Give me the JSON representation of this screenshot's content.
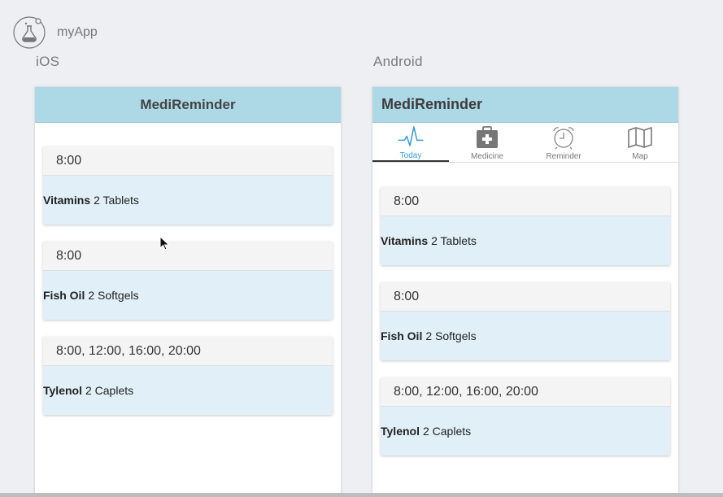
{
  "app": {
    "name": "myApp"
  },
  "platforms": {
    "ios_label": "iOS",
    "android_label": "Android"
  },
  "screen": {
    "title": "MediReminder"
  },
  "tabs": [
    {
      "label": "Today",
      "icon": "heartbeat-icon",
      "active": true
    },
    {
      "label": "Medicine",
      "icon": "medkit-icon",
      "active": false
    },
    {
      "label": "Reminder",
      "icon": "alarm-clock-icon",
      "active": false
    },
    {
      "label": "Map",
      "icon": "map-icon",
      "active": false
    }
  ],
  "reminders": [
    {
      "time": "8:00",
      "name": "Vitamins",
      "dose": "2 Tablets"
    },
    {
      "time": "8:00",
      "name": "Fish Oil",
      "dose": "2 Softgels"
    },
    {
      "time": "8:00, 12:00, 16:00, 20:00",
      "name": "Tylenol",
      "dose": "2 Caplets"
    }
  ],
  "colors": {
    "titlebar": "#add8e6",
    "card_body": "#e1f0f8",
    "active_tab": "#3a9ad9"
  }
}
